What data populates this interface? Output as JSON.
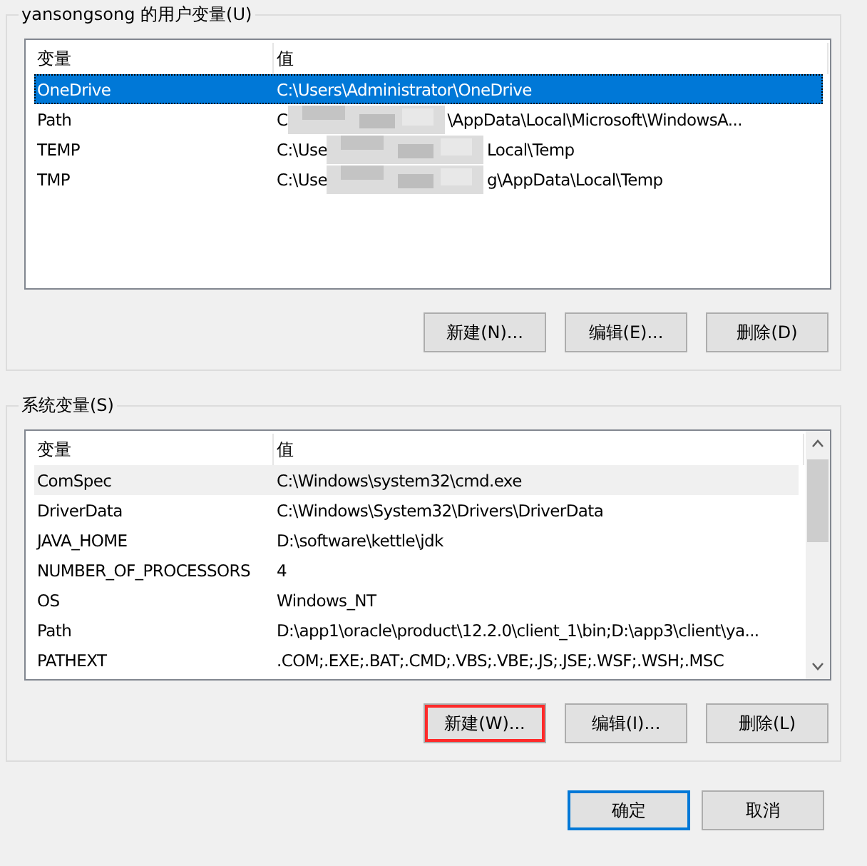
{
  "user_vars": {
    "title": "yansongsong 的用户变量(U)",
    "columns": [
      "变量",
      "值"
    ],
    "rows": [
      {
        "name": "OneDrive",
        "value": "C:\\Users\\Administrator\\OneDrive",
        "selected": true,
        "redacted": false
      },
      {
        "name": "Path",
        "value": "C",
        "value_end": "\\AppData\\Local\\Microsoft\\WindowsA...",
        "selected": false,
        "redacted": true
      },
      {
        "name": "TEMP",
        "value": "C:\\Use",
        "value_end": "Local\\Temp",
        "selected": false,
        "redacted": true
      },
      {
        "name": "TMP",
        "value": "C:\\Use",
        "value_end": "g\\AppData\\Local\\Temp",
        "selected": false,
        "redacted": true
      }
    ],
    "buttons": [
      {
        "label": "新建(N)...",
        "highlighted": false
      },
      {
        "label": "编辑(E)...",
        "highlighted": false
      },
      {
        "label": "删除(D)",
        "highlighted": false
      }
    ]
  },
  "system_vars": {
    "title": "系统变量(S)",
    "columns": [
      "变量",
      "值"
    ],
    "rows": [
      {
        "name": "ComSpec",
        "value": "C:\\Windows\\system32\\cmd.exe",
        "selected": true,
        "redacted": false
      },
      {
        "name": "DriverData",
        "value": "C:\\Windows\\System32\\Drivers\\DriverData",
        "selected": false,
        "redacted": false
      },
      {
        "name": "JAVA_HOME",
        "value": "D:\\software\\kettle\\jdk",
        "selected": false,
        "redacted": false
      },
      {
        "name": "NUMBER_OF_PROCESSORS",
        "value": "4",
        "selected": false,
        "redacted": false
      },
      {
        "name": "OS",
        "value": "Windows_NT",
        "selected": false,
        "redacted": false
      },
      {
        "name": "Path",
        "value": "D:\\app1\\oracle\\product\\12.2.0\\client_1\\bin;D:\\app3\\client\\ya...",
        "selected": false,
        "redacted": false
      },
      {
        "name": "PATHEXT",
        "value": ".COM;.EXE;.BAT;.CMD;.VBS;.VBE;.JS;.JSE;.WSF;.WSH;.MSC",
        "selected": false,
        "redacted": false
      }
    ],
    "buttons": [
      {
        "label": "新建(W)...",
        "highlighted": true
      },
      {
        "label": "编辑(I)...",
        "highlighted": false
      },
      {
        "label": "删除(L)",
        "highlighted": false
      }
    ]
  },
  "dialog_buttons": [
    {
      "label": "确定",
      "default": true
    },
    {
      "label": "取消",
      "default": false
    }
  ]
}
